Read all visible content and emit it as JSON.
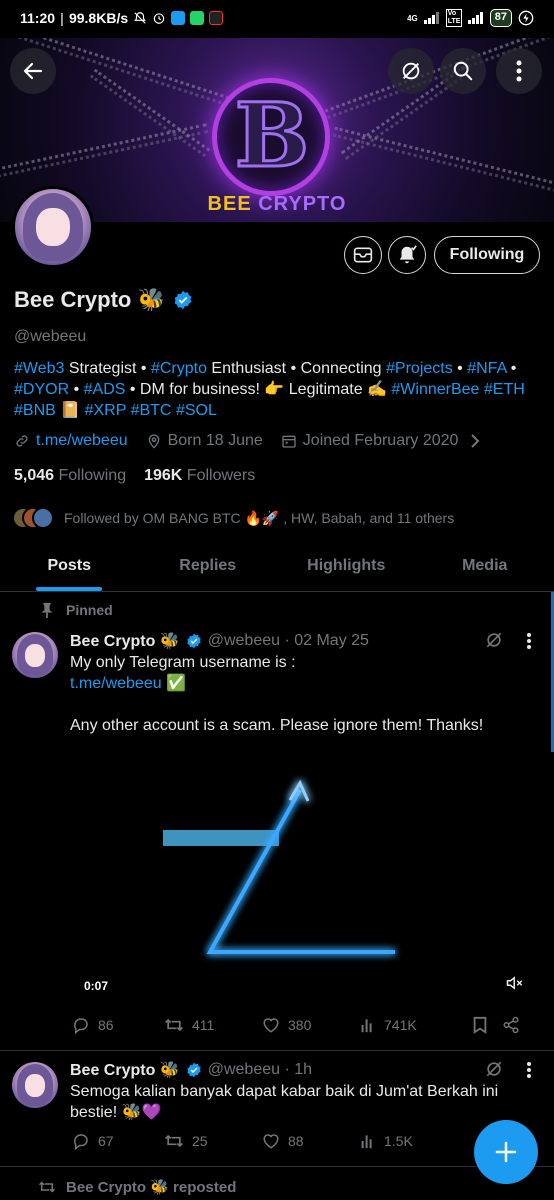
{
  "status_bar": {
    "time": "11:20",
    "speed": "99.8KB/s",
    "network": "4G",
    "volte": "Vo LTE",
    "battery": "87"
  },
  "banner": {
    "title_part1": "BEE",
    "title_part2": "CRYPTO",
    "logo_letter": "B"
  },
  "profile": {
    "following_label": "Following",
    "display_name": "Bee Crypto 🐝",
    "handle": "@webeeu",
    "bio": [
      {
        "t": "#Web3",
        "tag": true
      },
      {
        "t": " Strategist • ",
        "tag": false
      },
      {
        "t": "#Crypto",
        "tag": true
      },
      {
        "t": " Enthusiast • Connecting ",
        "tag": false
      },
      {
        "t": "#Projects",
        "tag": true
      },
      {
        "t": " • ",
        "tag": false
      },
      {
        "t": "#NFA",
        "tag": true
      },
      {
        "t": " • ",
        "tag": false
      },
      {
        "t": "#DYOR",
        "tag": true
      },
      {
        "t": " • ",
        "tag": false
      },
      {
        "t": "#ADS",
        "tag": true
      },
      {
        "t": "  • DM for business!  👉 Legitimate ✍️ ",
        "tag": false
      },
      {
        "t": "#WinnerBee",
        "tag": true
      },
      {
        "t": " ",
        "tag": false
      },
      {
        "t": "#ETH",
        "tag": true
      },
      {
        "t": " ",
        "tag": false
      },
      {
        "t": "#BNB",
        "tag": true
      },
      {
        "t": " 📔 ",
        "tag": false
      },
      {
        "t": "#XRP",
        "tag": true
      },
      {
        "t": " ",
        "tag": false
      },
      {
        "t": "#BTC",
        "tag": true
      },
      {
        "t": " ",
        "tag": false
      },
      {
        "t": "#SOL",
        "tag": true
      }
    ],
    "link": "t.me/webeeu",
    "born": "Born 18 June",
    "joined": "Joined February 2020",
    "following_count": "5,046",
    "following_text": "Following",
    "followers_count": "196K",
    "followers_text": "Followers",
    "followed_by": "Followed by OM BANG BTC 🔥🚀 , HW, Babah, and 11 others"
  },
  "tabs": [
    {
      "label": "Posts",
      "active": true
    },
    {
      "label": "Replies",
      "active": false
    },
    {
      "label": "Highlights",
      "active": false
    },
    {
      "label": "Media",
      "active": false
    }
  ],
  "pinned_label": "Pinned",
  "tweets": [
    {
      "name": "Bee Crypto 🐝",
      "handle_date": "@webeeu · 02 May 25",
      "line1": "My only Telegram username is :",
      "link": "t.me/webeeu",
      "link_suffix": " ✅",
      "line3": "Any other account is a scam. Please ignore them! Thanks!",
      "video_time": "0:07",
      "replies": "86",
      "reposts": "411",
      "likes": "380",
      "views": "741K"
    },
    {
      "name": "Bee Crypto 🐝",
      "handle_date": "@webeeu · 1h",
      "text": "Semoga kalian banyak dapat kabar baik di Jum'at Berkah ini bestie! 🐝💜",
      "replies": "67",
      "reposts": "25",
      "likes": "88",
      "views": "1.5K"
    }
  ],
  "repost_label": "Bee Crypto 🐝 reposted",
  "colors": {
    "accent": "#1d9bf0",
    "muted": "#71767b",
    "text": "#e7e9ea",
    "background": "#000000"
  },
  "icons": [
    "back-arrow-icon",
    "grok-icon",
    "search-icon",
    "more-vertical-icon",
    "mail-icon",
    "bell-icon",
    "verified-icon",
    "link-icon",
    "location-icon",
    "calendar-icon",
    "chevron-right-icon",
    "pin-icon",
    "reply-icon",
    "repost-icon",
    "like-icon",
    "views-icon",
    "bookmark-icon",
    "share-icon",
    "mute-icon",
    "plus-icon"
  ]
}
